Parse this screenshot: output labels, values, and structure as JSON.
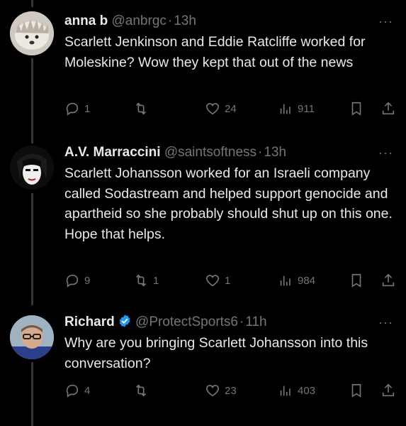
{
  "tweets": [
    {
      "name": "anna b",
      "handle": "@anbrgc",
      "time": "13h",
      "text": "Scarlett Jenkinson and Eddie Ratcliffe worked for Moleskine? Wow they kept that out of the news",
      "replies": "1",
      "retweets": "",
      "likes": "24",
      "views": "911",
      "verified": false
    },
    {
      "name": "A.V. Marraccini",
      "handle": "@saintsoftness",
      "time": "13h",
      "text": "Scarlett Johansson worked for an Israeli company called Sodastream and helped support genocide and apartheid so she probably should shut up on this one. Hope that helps.",
      "replies": "9",
      "retweets": "1",
      "likes": "1",
      "views": "984",
      "verified": false
    },
    {
      "name": "Richard",
      "handle": "@ProtectSports6",
      "time": "11h",
      "text": "Why are you bringing Scarlett Johansson into this conversation?",
      "replies": "4",
      "retweets": "",
      "likes": "23",
      "views": "403",
      "verified": true
    }
  ],
  "separator": "·",
  "icons": [
    "reply-icon",
    "retweet-icon",
    "like-icon",
    "views-icon",
    "bookmark-icon",
    "share-icon",
    "more-icon",
    "verified-badge-icon"
  ],
  "colors": {
    "background": "#000000",
    "text": "#e7e9ea",
    "muted": "#71767b",
    "verified": "#1d9bf0",
    "thread_line": "#333639"
  }
}
